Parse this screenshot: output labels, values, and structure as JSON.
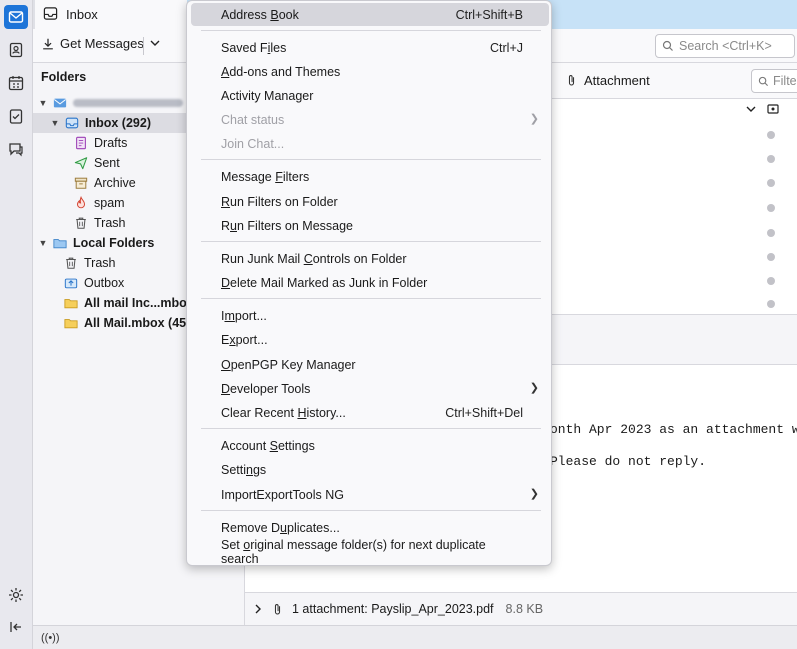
{
  "tab": {
    "title": "Inbox",
    "icon": "mail-tab-icon"
  },
  "toolbar": {
    "get_messages": "Get Messages",
    "search_placeholder": "Search <Ctrl+K>"
  },
  "spaces": [
    {
      "name": "mail-icon",
      "active": true
    },
    {
      "name": "address-book-icon"
    },
    {
      "name": "calendar-icon"
    },
    {
      "name": "tasks-icon"
    },
    {
      "name": "chat-icon"
    }
  ],
  "folders": {
    "header": "Folders",
    "inbox_label": "Inbox (292)",
    "drafts": "Drafts",
    "sent": "Sent",
    "archive": "Archive",
    "spam": "spam",
    "trash": "Trash",
    "local_folders": "Local Folders",
    "local_trash": "Trash",
    "outbox": "Outbox",
    "all_mail_inc": "All mail Inc...mbo",
    "all_mail_mbox": "All Mail.mbox (45"
  },
  "message_list": {
    "attachment_col": "Attachment",
    "filter_placeholder": "Filter"
  },
  "message_body": {
    "line1": "onth Apr 2023 as an attachment w",
    "line2": "Please do not reply."
  },
  "attachment_bar": {
    "label": "1 attachment: Payslip_Apr_2023.pdf",
    "size": "8.8 KB"
  },
  "menu": {
    "address_book": "Address Book",
    "address_book_sc": "Ctrl+Shift+B",
    "saved_files": "Saved Files",
    "saved_files_sc": "Ctrl+J",
    "addons": "Add-ons and Themes",
    "activity": "Activity Manager",
    "chat_status": "Chat status",
    "join_chat": "Join Chat...",
    "message_filters": "Message Filters",
    "run_filters_folder": "Run Filters on Folder",
    "run_filters_message": "Run Filters on Message",
    "run_junk": "Run Junk Mail Controls on Folder",
    "delete_junk": "Delete Mail Marked as Junk in Folder",
    "import": "Import...",
    "export": "Export...",
    "openpgp": "OpenPGP Key Manager",
    "developer": "Developer Tools",
    "clear_history": "Clear Recent History...",
    "clear_history_sc": "Ctrl+Shift+Del",
    "account_settings": "Account Settings",
    "settings": "Settings",
    "importexport": "ImportExportTools NG",
    "remove_dupes": "Remove Duplicates...",
    "set_original": "Set original message folder(s) for next duplicate search"
  }
}
